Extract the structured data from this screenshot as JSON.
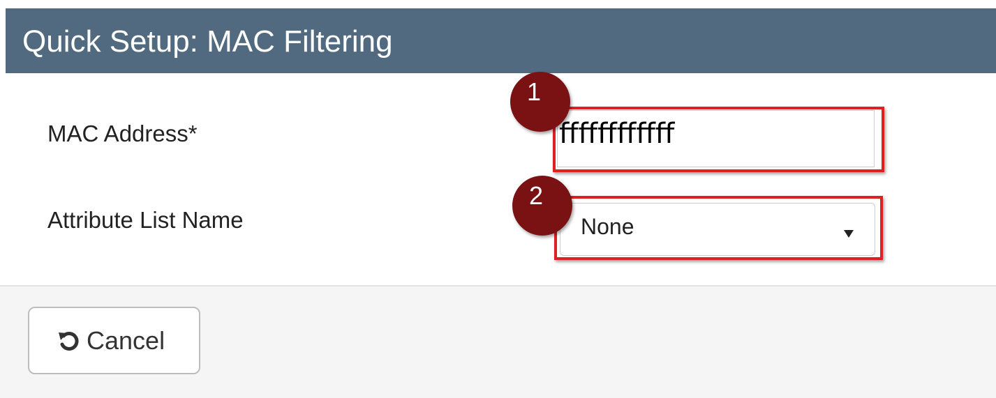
{
  "dialog": {
    "title": "Quick Setup: MAC Filtering",
    "header_color": "#516a80"
  },
  "form": {
    "mac_address_label": "MAC Address*",
    "mac_address_value": "ffffffffffff",
    "attribute_list_label": "Attribute List Name",
    "attribute_list_selected": "None"
  },
  "callouts": [
    {
      "number": "1",
      "target": "mac-address-input"
    },
    {
      "number": "2",
      "target": "attribute-list-select"
    }
  ],
  "callout_color": "#7a1214",
  "highlight_color": "#e0201e",
  "footer": {
    "cancel_label": "Cancel",
    "cancel_icon": "undo-icon"
  }
}
